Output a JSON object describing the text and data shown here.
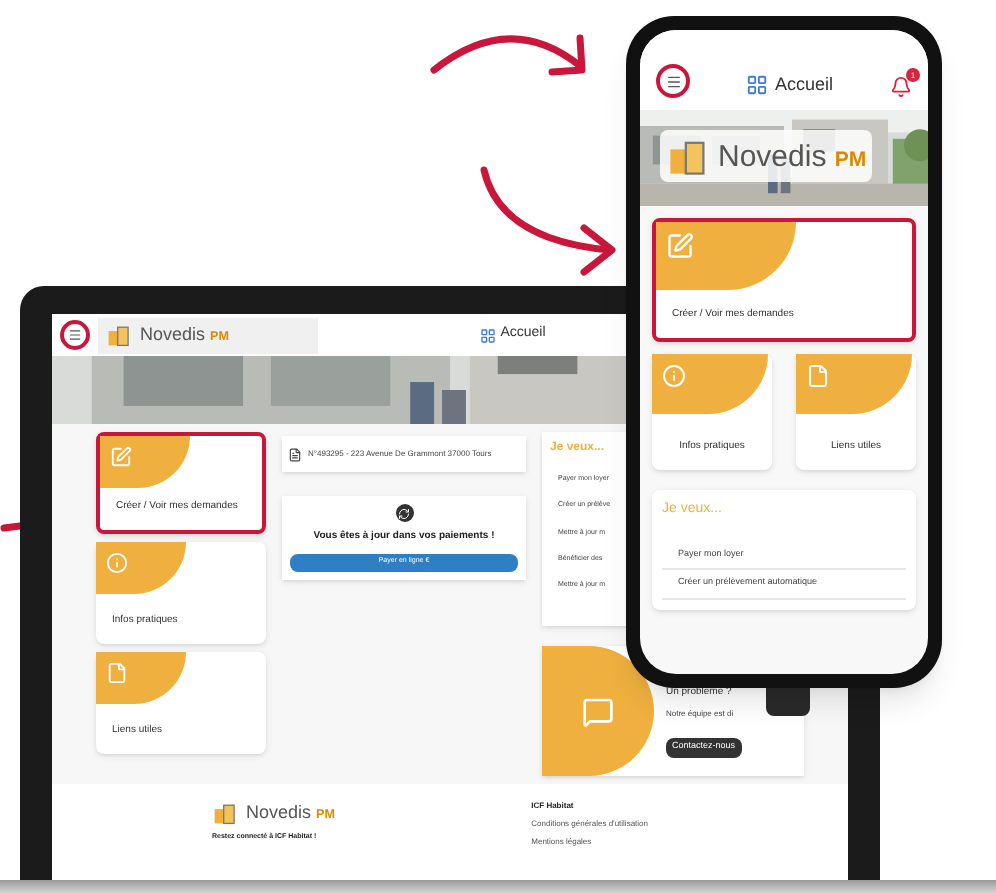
{
  "laptop": {
    "header": {
      "menu_highlighted": true,
      "logo": {
        "name": "Novedis",
        "suffix": "PM"
      },
      "title": "Accueil"
    },
    "tiles": [
      {
        "kind": "edit",
        "label": "Créer / Voir mes demandes",
        "highlighted": true
      },
      {
        "kind": "info",
        "label": "Infos pratiques",
        "highlighted": false
      },
      {
        "kind": "file",
        "label": "Liens utiles",
        "highlighted": false
      }
    ],
    "address": "N°493295 - 223 Avenue De Grammont 37000 Tours",
    "payment": {
      "message": "Vous êtes à jour dans vos paiements !",
      "button": "Payer en ligne €"
    },
    "wishes": {
      "title": "Je veux...",
      "items": [
        "Payer mon loyer",
        "Créer un prélève",
        "Mettre à jour m",
        "Bénéficier des",
        "Mettre à jour m"
      ]
    },
    "problem": {
      "title": "Un problème ?",
      "text": "Notre équipe est di",
      "button": "Contactez-nous"
    },
    "footer": {
      "logo": {
        "name": "Novedis",
        "suffix": "PM"
      },
      "tagline": "Restez connecté à ICF Habitat !",
      "heading": "ICF Habitat",
      "links": [
        "Conditions générales d'utilisation",
        "Mentions légales"
      ]
    }
  },
  "phone": {
    "header": {
      "menu_highlighted": true,
      "title": "Accueil",
      "badge": "1"
    },
    "logo": {
      "name": "Novedis",
      "suffix": "PM"
    },
    "tiles": [
      {
        "kind": "edit",
        "label": "Créer / Voir mes demandes",
        "highlighted": true
      },
      {
        "kind": "info",
        "label": "Infos pratiques",
        "highlighted": false
      },
      {
        "kind": "file",
        "label": "Liens utiles",
        "highlighted": false
      }
    ],
    "wishes": {
      "title": "Je veux...",
      "items": [
        "Payer mon loyer",
        "Créer un prélèvement automatique"
      ]
    }
  }
}
